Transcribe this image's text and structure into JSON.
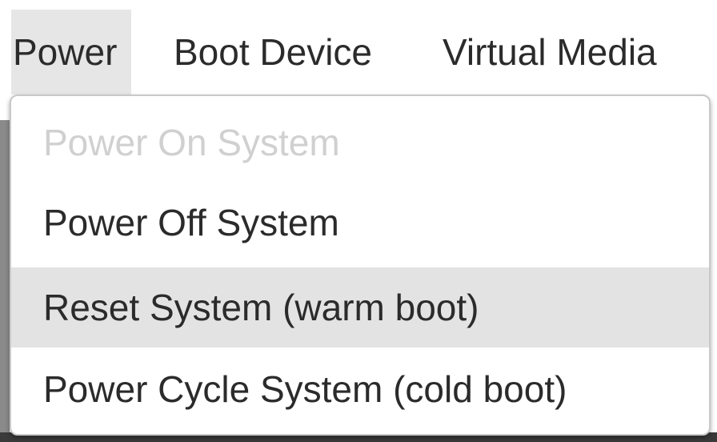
{
  "menubar": {
    "items": [
      {
        "label": "Power",
        "active": true
      },
      {
        "label": "Boot Device",
        "active": false
      },
      {
        "label": "Virtual Media",
        "active": false
      }
    ]
  },
  "dropdown": {
    "items": [
      {
        "label": "Power On System",
        "state": "disabled"
      },
      {
        "label": "Power Off System",
        "state": "enabled"
      },
      {
        "label": "Reset System (warm boot)",
        "state": "hovered"
      },
      {
        "label": "Power Cycle System (cold boot)",
        "state": "enabled"
      }
    ]
  },
  "colors": {
    "text": "#2b2b2b",
    "disabled_text": "#d0d0d0",
    "active_menu_bg": "#e6e6e6",
    "hover_item_bg": "#e3e3e3"
  }
}
